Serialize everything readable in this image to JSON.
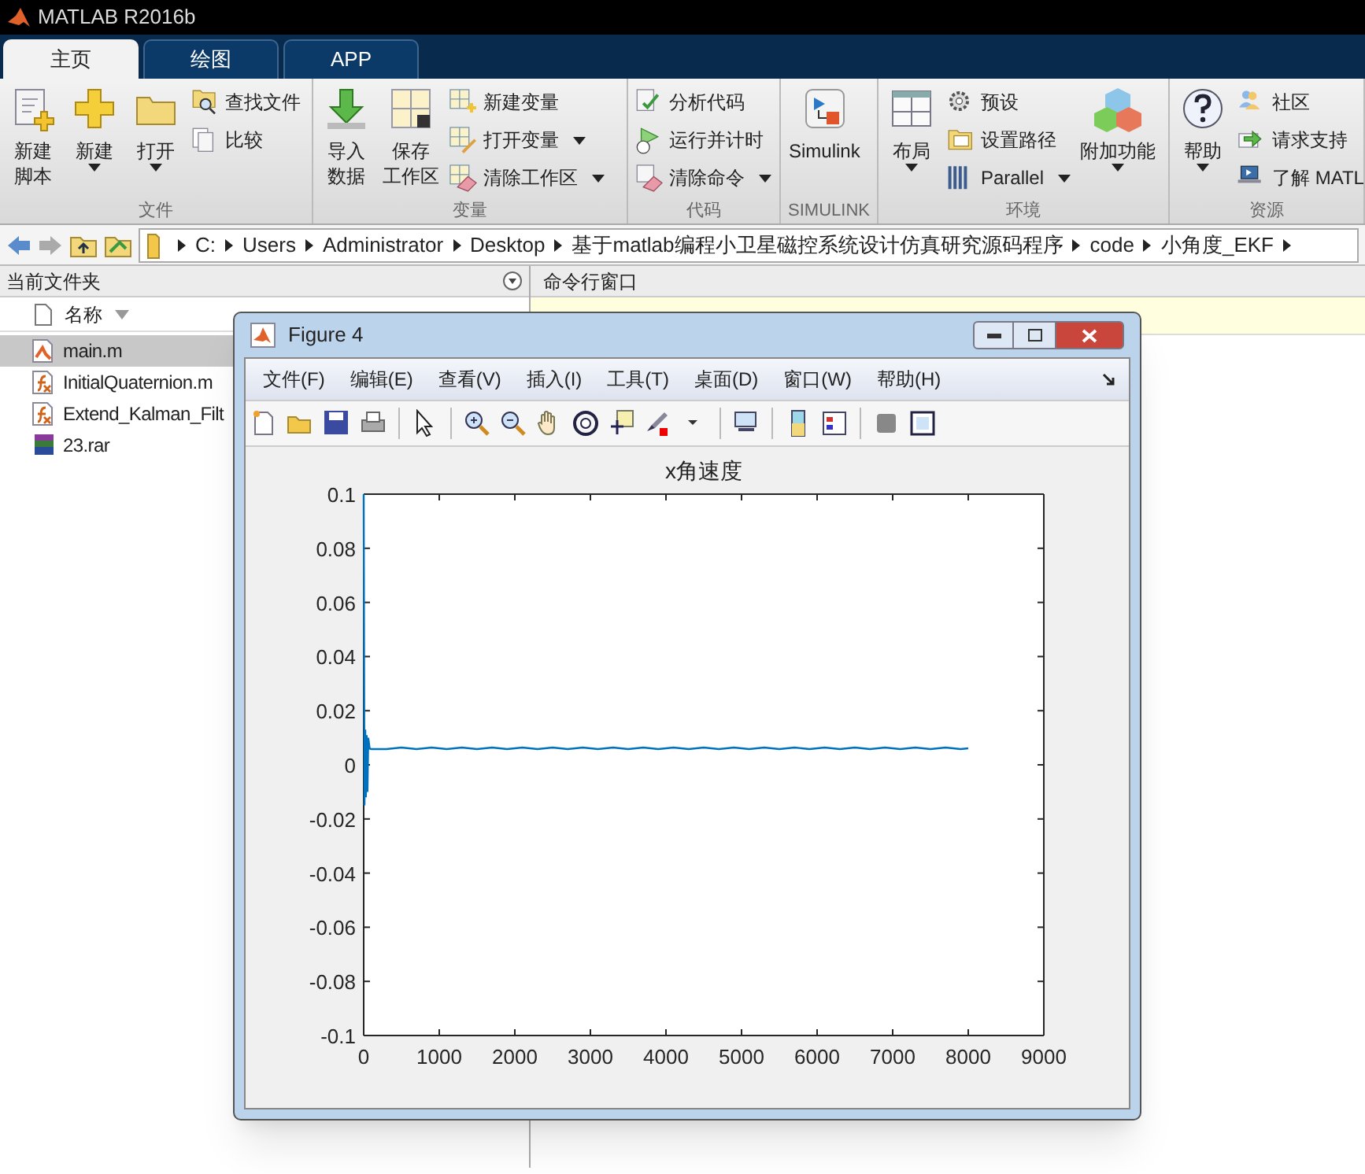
{
  "window": {
    "title": "MATLAB R2016b"
  },
  "tabs": [
    {
      "label": "主页",
      "selected": true
    },
    {
      "label": "绘图",
      "selected": false
    },
    {
      "label": "APP",
      "selected": false
    }
  ],
  "ribbon": [
    {
      "label": "文件",
      "columns": [
        [
          {
            "kind": "large",
            "lines": [
              "新建",
              "脚本"
            ],
            "dropdown": false
          }
        ],
        [
          {
            "kind": "large",
            "lines": [
              "新建"
            ],
            "dropdown": true
          }
        ],
        [
          {
            "kind": "large",
            "lines": [
              "打开"
            ],
            "dropdown": true
          }
        ],
        [
          {
            "kind": "small",
            "label": "查找文件",
            "dropdown": false
          },
          {
            "kind": "small",
            "label": "比较",
            "dropdown": false
          }
        ]
      ]
    },
    {
      "label": "变量",
      "columns": [
        [
          {
            "kind": "large",
            "lines": [
              "导入",
              "数据"
            ],
            "dropdown": false
          }
        ],
        [
          {
            "kind": "large",
            "lines": [
              "保存",
              "工作区"
            ],
            "dropdown": false
          }
        ],
        [
          {
            "kind": "small",
            "label": "新建变量",
            "dropdown": false
          },
          {
            "kind": "small",
            "label": "打开变量",
            "dropdown": true
          },
          {
            "kind": "small",
            "label": "清除工作区",
            "dropdown": true
          }
        ]
      ]
    },
    {
      "label": "代码",
      "columns": [
        [
          {
            "kind": "small",
            "label": "分析代码",
            "dropdown": false
          },
          {
            "kind": "small",
            "label": "运行并计时",
            "dropdown": false
          },
          {
            "kind": "small",
            "label": "清除命令",
            "dropdown": true
          }
        ]
      ]
    },
    {
      "label": "SIMULINK",
      "columns": [
        [
          {
            "kind": "large",
            "lines": [
              "Simulink"
            ],
            "dropdown": false
          }
        ]
      ]
    },
    {
      "label": "环境",
      "columns": [
        [
          {
            "kind": "large",
            "lines": [
              "布局"
            ],
            "dropdown": true
          }
        ],
        [
          {
            "kind": "small",
            "label": "预设",
            "dropdown": false
          },
          {
            "kind": "small",
            "label": "设置路径",
            "dropdown": false
          },
          {
            "kind": "small",
            "label": "Parallel",
            "dropdown": true
          }
        ],
        [
          {
            "kind": "large",
            "lines": [
              "附加功能"
            ],
            "dropdown": true
          }
        ]
      ]
    },
    {
      "label": "资源",
      "columns": [
        [
          {
            "kind": "large",
            "lines": [
              "帮助"
            ],
            "dropdown": true
          }
        ],
        [
          {
            "kind": "small",
            "label": "社区",
            "dropdown": false
          },
          {
            "kind": "small",
            "label": "请求支持",
            "dropdown": false
          },
          {
            "kind": "small",
            "label": "了解 MATL",
            "dropdown": false
          }
        ]
      ]
    }
  ],
  "address_bar": {
    "path": [
      "C:",
      "Users",
      "Administrator",
      "Desktop",
      "基于matlab编程小卫星磁控系统设计仿真研究源码程序",
      "code",
      "小角度_EKF"
    ]
  },
  "current_folder": {
    "title": "当前文件夹",
    "column": "名称",
    "files": [
      {
        "name": "main.m",
        "kind": "script",
        "selected": true
      },
      {
        "name": "InitialQuaternion.m",
        "kind": "function",
        "selected": false
      },
      {
        "name": "Extend_Kalman_Filt",
        "kind": "function",
        "selected": false
      },
      {
        "name": "23.rar",
        "kind": "archive",
        "selected": false
      }
    ]
  },
  "command_window": {
    "title": "命令行窗口"
  },
  "figure": {
    "title": "Figure 4",
    "menu": [
      "文件(F)",
      "编辑(E)",
      "查看(V)",
      "插入(I)",
      "工具(T)",
      "桌面(D)",
      "窗口(W)",
      "帮助(H)"
    ],
    "chart_data": {
      "type": "line",
      "title": "x角速度",
      "xlim": [
        0,
        9000
      ],
      "ylim": [
        -0.1,
        0.1
      ],
      "xticks": [
        0,
        1000,
        2000,
        3000,
        4000,
        5000,
        6000,
        7000,
        8000,
        9000
      ],
      "yticks": [
        -0.1,
        -0.08,
        -0.06,
        -0.04,
        -0.02,
        0,
        0.02,
        0.04,
        0.06,
        0.08,
        0.1
      ],
      "x": [
        0,
        10,
        20,
        30,
        40,
        50,
        60,
        80,
        100,
        300,
        500,
        700,
        900,
        1100,
        1300,
        1500,
        1700,
        1900,
        2100,
        2300,
        2500,
        2700,
        2900,
        3100,
        3300,
        3500,
        3700,
        3900,
        4100,
        4300,
        4500,
        4700,
        4900,
        5100,
        5300,
        5500,
        5700,
        5900,
        6100,
        6300,
        6500,
        6700,
        6900,
        7100,
        7300,
        7500,
        7700,
        7900,
        8000
      ],
      "series": [
        {
          "color": "#0072bd",
          "values": [
            0.1,
            -0.015,
            0.013,
            -0.012,
            0.011,
            -0.01,
            0.01,
            0.006,
            0.0058,
            0.0058,
            0.0064,
            0.0058,
            0.0064,
            0.0058,
            0.0064,
            0.0058,
            0.0064,
            0.0058,
            0.0064,
            0.0058,
            0.0064,
            0.0058,
            0.0064,
            0.0058,
            0.0064,
            0.0058,
            0.0064,
            0.0058,
            0.0064,
            0.0058,
            0.0064,
            0.0058,
            0.0064,
            0.0058,
            0.0064,
            0.0058,
            0.0064,
            0.0058,
            0.0064,
            0.0058,
            0.0064,
            0.0058,
            0.0064,
            0.0058,
            0.0064,
            0.0058,
            0.0064,
            0.0058,
            0.0061
          ]
        }
      ]
    }
  }
}
